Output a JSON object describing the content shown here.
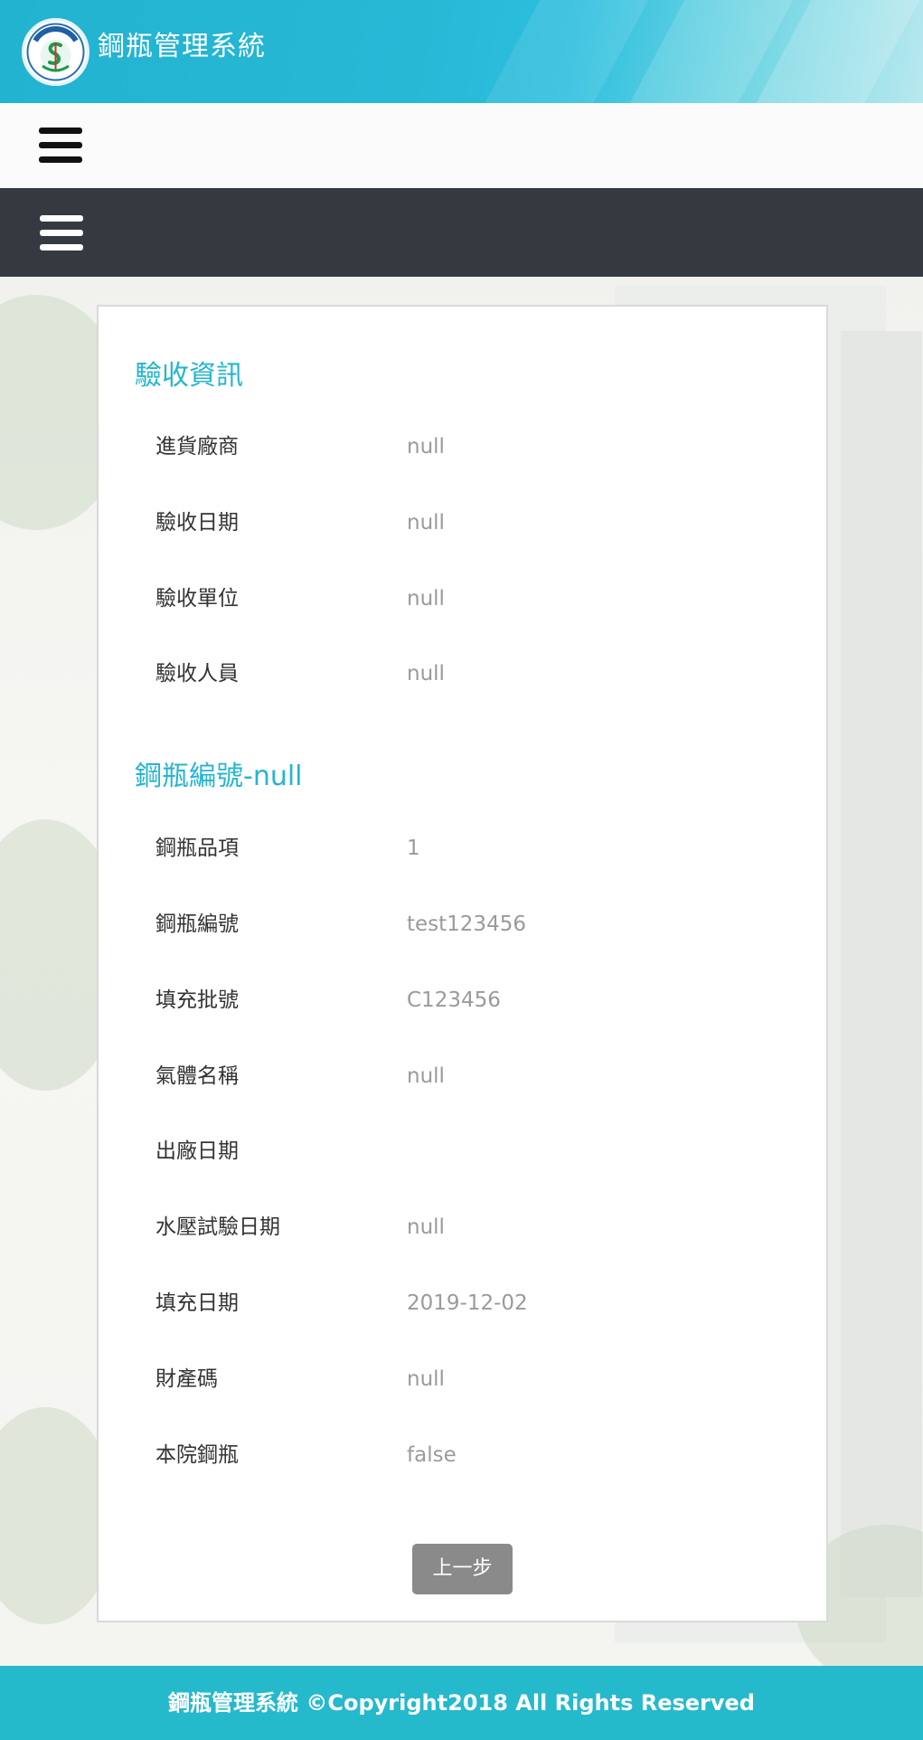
{
  "header": {
    "app_title": "鋼瓶管理系統"
  },
  "colors": {
    "accent": "#25b5cf",
    "header_start": "#21b3cf",
    "nav_dark": "#343a40",
    "button_gray": "#8a8a8a",
    "footer": "#25b9cc"
  },
  "icons": {
    "logo": "hospital-logo",
    "menu": "hamburger-icon"
  },
  "acceptance": {
    "title": "驗收資訊",
    "rows": [
      {
        "label": "進貨廠商",
        "value": "null"
      },
      {
        "label": "驗收日期",
        "value": "null"
      },
      {
        "label": "驗收單位",
        "value": "null"
      },
      {
        "label": "驗收人員",
        "value": "null"
      }
    ]
  },
  "cylinder": {
    "title": "鋼瓶編號-null",
    "rows": [
      {
        "label": "鋼瓶品項",
        "value": "1"
      },
      {
        "label": "鋼瓶編號",
        "value": "test123456"
      },
      {
        "label": "填充批號",
        "value": "C123456"
      },
      {
        "label": "氣體名稱",
        "value": "null"
      },
      {
        "label": "出廠日期",
        "value": ""
      },
      {
        "label": "水壓試驗日期",
        "value": "null"
      },
      {
        "label": "填充日期",
        "value": "2019-12-02"
      },
      {
        "label": "財產碼",
        "value": "null"
      },
      {
        "label": "本院鋼瓶",
        "value": "false"
      }
    ]
  },
  "actions": {
    "back_label": "上一步"
  },
  "footer": {
    "text": "鋼瓶管理系統 ©Copyright2018 All Rights Reserved"
  }
}
